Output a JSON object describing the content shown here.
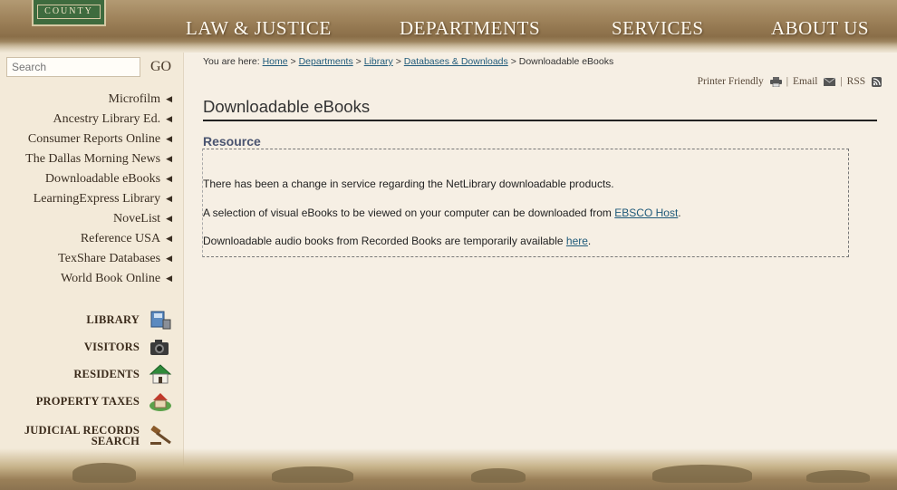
{
  "header": {
    "logo_text": "COUNTY",
    "nav": [
      "LAW & JUSTICE",
      "DEPARTMENTS",
      "SERVICES",
      "ABOUT US"
    ]
  },
  "sidebar": {
    "search_placeholder": "Search",
    "go_label": "GO",
    "items": [
      {
        "label": "Microfilm"
      },
      {
        "label": "Ancestry Library Ed."
      },
      {
        "label": "Consumer Reports Online"
      },
      {
        "label": "The Dallas Morning News"
      },
      {
        "label": "Downloadable eBooks"
      },
      {
        "label": "LearningExpress Library"
      },
      {
        "label": "NoveList"
      },
      {
        "label": "Reference USA"
      },
      {
        "label": "TexShare Databases"
      },
      {
        "label": "World Book Online"
      }
    ],
    "quick_links": [
      {
        "label": "LIBRARY",
        "icon": "library-icon"
      },
      {
        "label": "VISITORS",
        "icon": "camera-icon"
      },
      {
        "label": "RESIDENTS",
        "icon": "house-icon"
      },
      {
        "label": "PROPERTY TAXES",
        "icon": "property-icon"
      },
      {
        "label_line1": "JUDICIAL RECORDS",
        "label_line2": "SEARCH",
        "icon": "gavel-icon"
      }
    ]
  },
  "breadcrumb": {
    "prefix": "You are here:",
    "links": [
      "Home",
      "Departments",
      "Library",
      "Databases & Downloads"
    ],
    "separator": ">",
    "current": "Downloadable eBooks"
  },
  "tools": {
    "printer": "Printer Friendly",
    "email": "Email",
    "rss": "RSS",
    "separator": "|"
  },
  "main": {
    "title": "Downloadable eBooks",
    "section": "Resource",
    "line1": "There has been a change in service regarding the NetLibrary downloadable products.",
    "line2_text": "A selection of visual eBooks to be viewed on your computer can be downloaded from ",
    "line2_link": "EBSCO Host",
    "line2_end": ".",
    "line3_text": "Downloadable audio books from Recorded Books are temporarily available ",
    "line3_link": "here",
    "line3_end": "."
  },
  "colors": {
    "link": "#1f5a7a",
    "section_heading": "#4a5470",
    "logo_green": "#3e6b3e"
  }
}
